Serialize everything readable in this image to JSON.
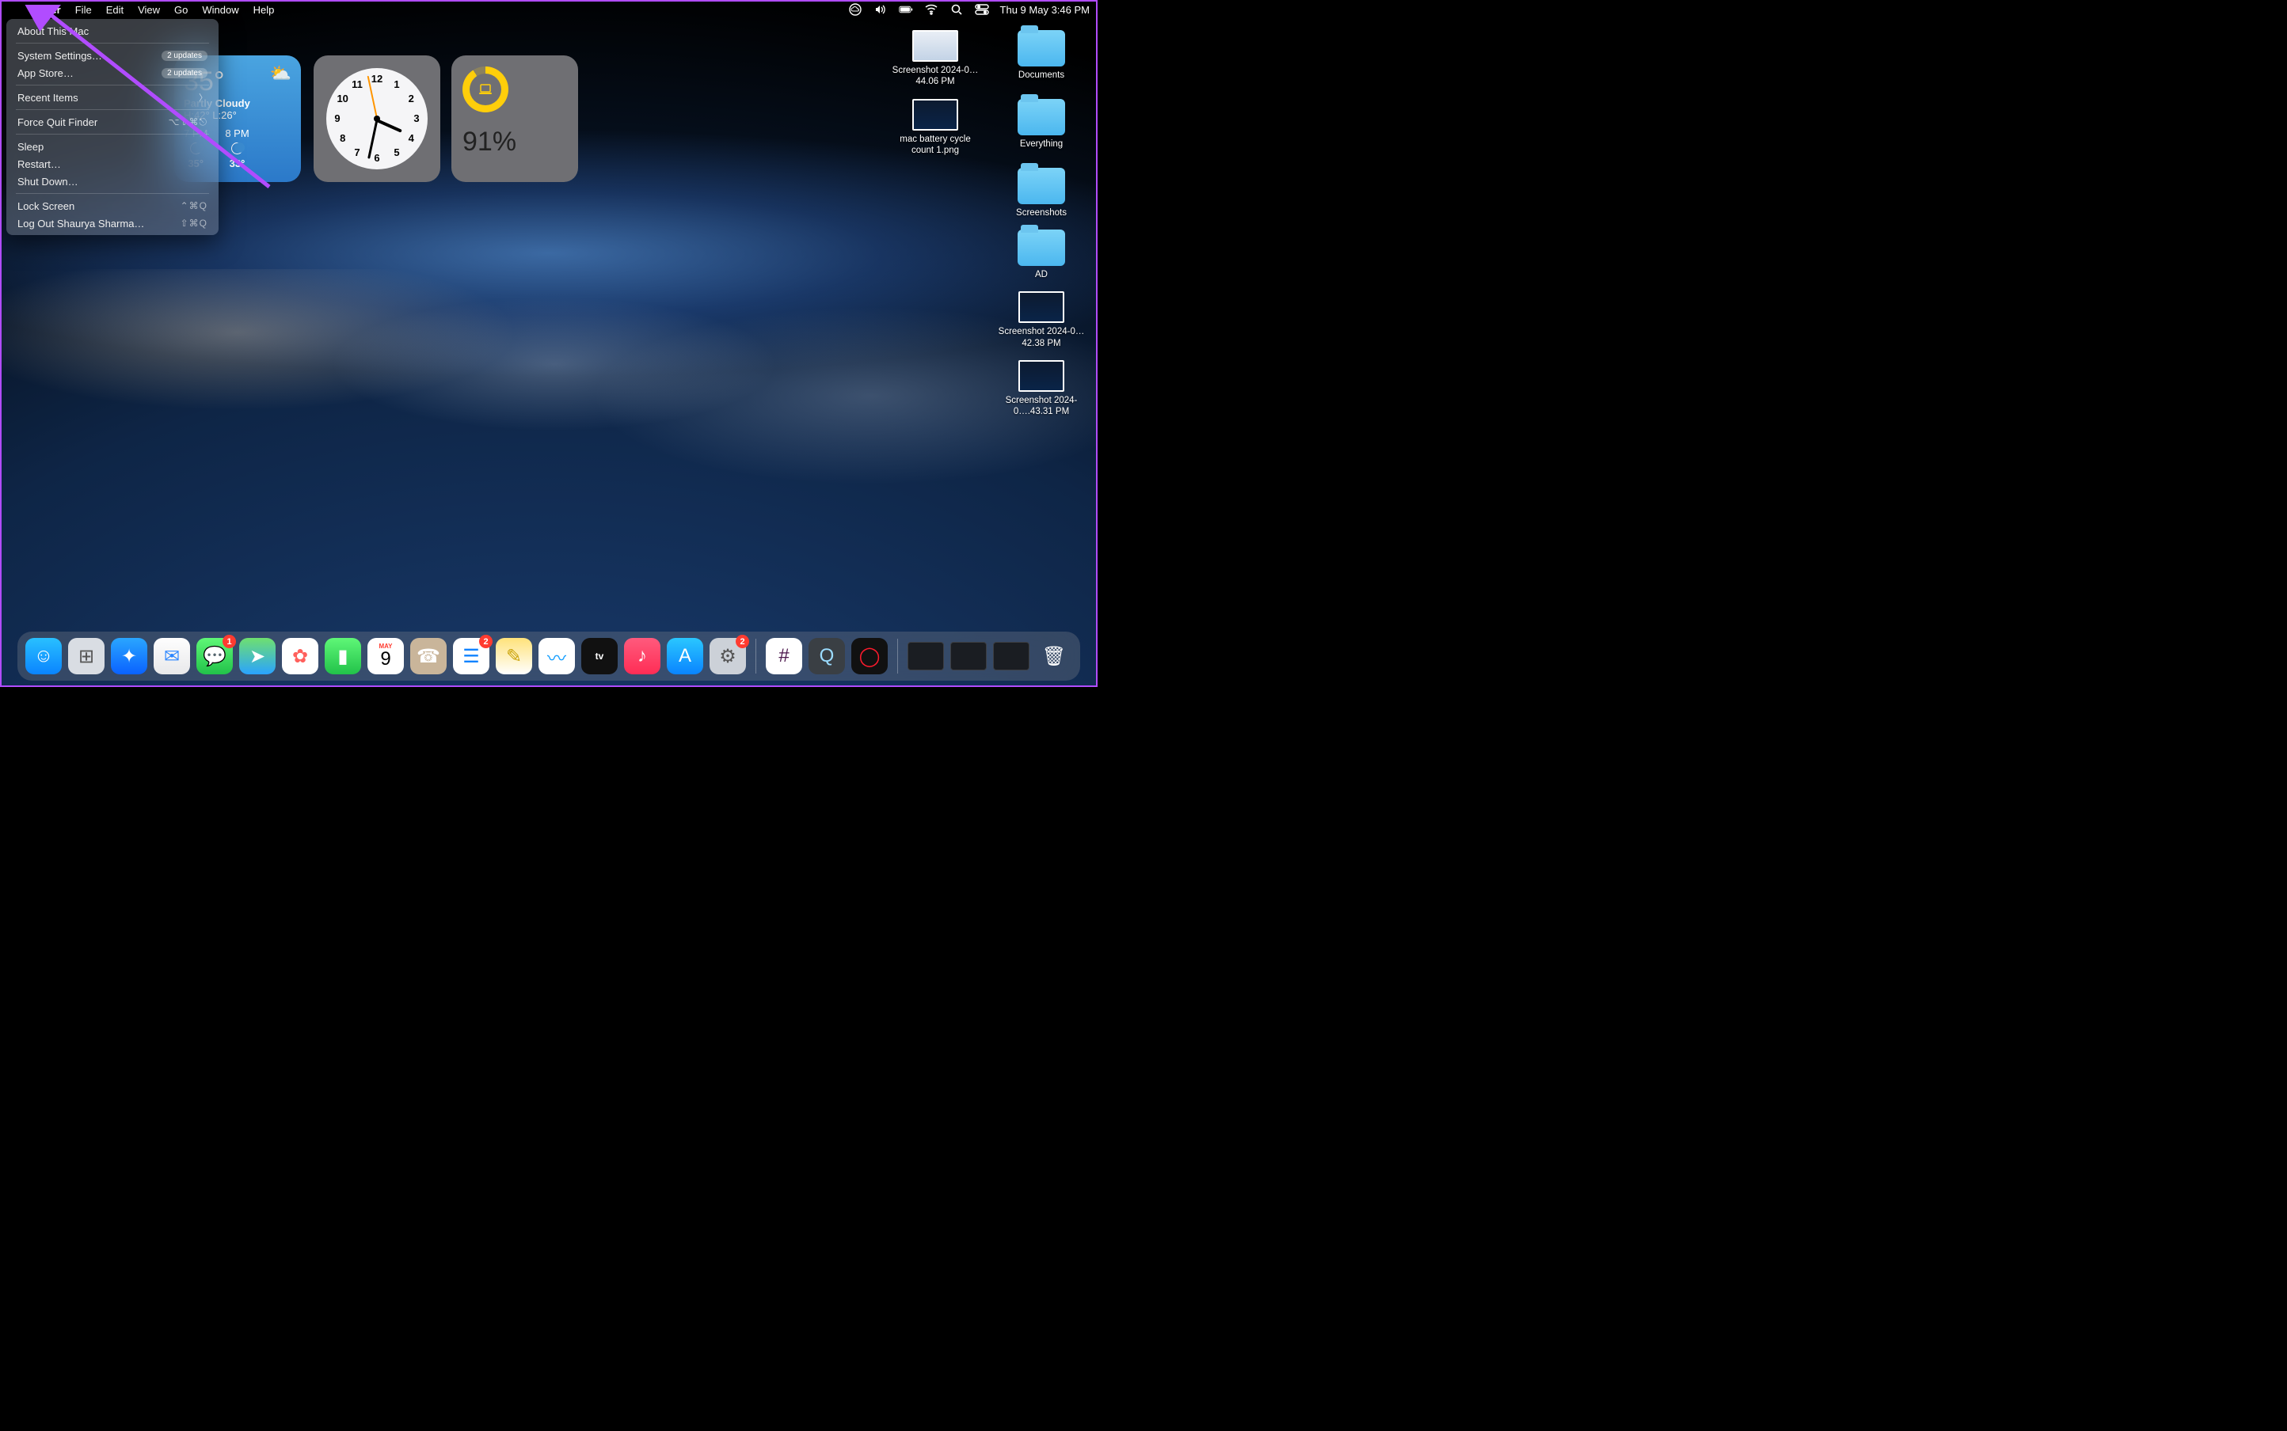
{
  "menubar": {
    "app": "Finder",
    "items": [
      "File",
      "Edit",
      "View",
      "Go",
      "Window",
      "Help"
    ],
    "datetime": "Thu 9 May  3:46 PM"
  },
  "apple_menu": {
    "about": "About This Mac",
    "settings": "System Settings…",
    "settings_badge": "2 updates",
    "appstore": "App Store…",
    "appstore_badge": "2 updates",
    "recent": "Recent Items",
    "forcequit": "Force Quit Finder",
    "forcequit_sc": "⌥⇧⌘⎋",
    "sleep": "Sleep",
    "restart": "Restart…",
    "shutdown": "Shut Down…",
    "lock": "Lock Screen",
    "lock_sc": "⌃⌘Q",
    "logout": "Log Out Shaurya Sharma…",
    "logout_sc": "⇧⌘Q"
  },
  "weather": {
    "temp": "35°",
    "cond": "Partly Cloudy",
    "hilo": "H:42° L:26°",
    "cols": [
      {
        "t": "7 PM",
        "v": "35°"
      },
      {
        "t": "8 PM",
        "v": "33°"
      }
    ]
  },
  "clock": {
    "numbers": [
      "12",
      "1",
      "2",
      "3",
      "4",
      "5",
      "6",
      "7",
      "8",
      "9",
      "10",
      "11"
    ]
  },
  "battery": {
    "pct": "91%"
  },
  "desktop_icons": [
    {
      "kind": "thumb",
      "variant": "light",
      "label": "Screenshot 2024-0…44.06 PM"
    },
    {
      "kind": "folder",
      "label": "Documents"
    },
    {
      "kind": "thumb",
      "variant": "dark",
      "label": "mac battery cycle count 1.png"
    },
    {
      "kind": "folder",
      "label": "Everything"
    },
    {
      "kind": "spacer"
    },
    {
      "kind": "folder",
      "label": "Screenshots"
    },
    {
      "kind": "spacer"
    },
    {
      "kind": "folder",
      "label": "AD"
    },
    {
      "kind": "spacer"
    },
    {
      "kind": "thumb",
      "variant": "dark",
      "label": "Screenshot 2024-0…42.38 PM"
    },
    {
      "kind": "spacer"
    },
    {
      "kind": "thumb",
      "variant": "dark",
      "label": "Screenshot 2024-0….43.31 PM"
    }
  ],
  "dock": [
    {
      "name": "finder",
      "bg": "linear-gradient(#29c0ff,#0a84ff)",
      "glyph": "☺",
      "badge": null
    },
    {
      "name": "launchpad",
      "bg": "#d9dde3",
      "glyph": "⊞",
      "badge": null,
      "color": "#555"
    },
    {
      "name": "safari",
      "bg": "linear-gradient(#2aa6ff,#0a62ff)",
      "glyph": "✦",
      "badge": null
    },
    {
      "name": "mail",
      "bg": "linear-gradient(#fefefe,#e8e8ea)",
      "glyph": "✉",
      "badge": null,
      "color": "#2b86ff"
    },
    {
      "name": "messages",
      "bg": "linear-gradient(#5ff777,#22c24a)",
      "glyph": "💬",
      "badge": "1"
    },
    {
      "name": "maps",
      "bg": "linear-gradient(#6fe06f,#2aa3ff)",
      "glyph": "➤",
      "badge": null
    },
    {
      "name": "photos",
      "bg": "#fff",
      "glyph": "✿",
      "badge": null,
      "color": "#ff605c"
    },
    {
      "name": "facetime",
      "bg": "linear-gradient(#5ff777,#22c24a)",
      "glyph": "▮",
      "badge": null
    },
    {
      "name": "calendar",
      "bg": "#fff",
      "glyph": "9",
      "sub": "MAY",
      "badge": null,
      "color": "#000"
    },
    {
      "name": "contacts",
      "bg": "#c9b59a",
      "glyph": "☎",
      "badge": null
    },
    {
      "name": "reminders",
      "bg": "#fff",
      "glyph": "☰",
      "badge": "2",
      "color": "#1083ff"
    },
    {
      "name": "notes",
      "bg": "linear-gradient(#ffe27a,#fff)",
      "glyph": "✎",
      "badge": null,
      "color": "#caa208"
    },
    {
      "name": "freeform",
      "bg": "#fff",
      "glyph": "〰",
      "badge": null,
      "color": "#1aa1ff"
    },
    {
      "name": "tv",
      "bg": "#111",
      "glyph": "tv",
      "badge": null,
      "txt": true
    },
    {
      "name": "music",
      "bg": "linear-gradient(#ff5a7d,#ff2d55)",
      "glyph": "♪",
      "badge": null
    },
    {
      "name": "appstore",
      "bg": "linear-gradient(#2ac7ff,#0a84ff)",
      "glyph": "A",
      "badge": null
    },
    {
      "name": "settings",
      "bg": "#ccd1d8",
      "glyph": "⚙",
      "badge": "2",
      "color": "#555"
    },
    {
      "name": "sep"
    },
    {
      "name": "slack",
      "bg": "#fff",
      "glyph": "#",
      "badge": null,
      "color": "#4a154b"
    },
    {
      "name": "quicktime",
      "bg": "#3a3f44",
      "glyph": "Q",
      "badge": null,
      "color": "#9bdcff"
    },
    {
      "name": "opera",
      "bg": "#111",
      "glyph": "◯",
      "badge": null,
      "color": "#ff1b2d"
    },
    {
      "name": "sep"
    },
    {
      "name": "thumb1",
      "kind": "tile"
    },
    {
      "name": "thumb2",
      "kind": "tile"
    },
    {
      "name": "thumb3",
      "kind": "tile"
    },
    {
      "name": "trash",
      "bg": "transparent",
      "glyph": "🗑",
      "badge": null
    }
  ]
}
